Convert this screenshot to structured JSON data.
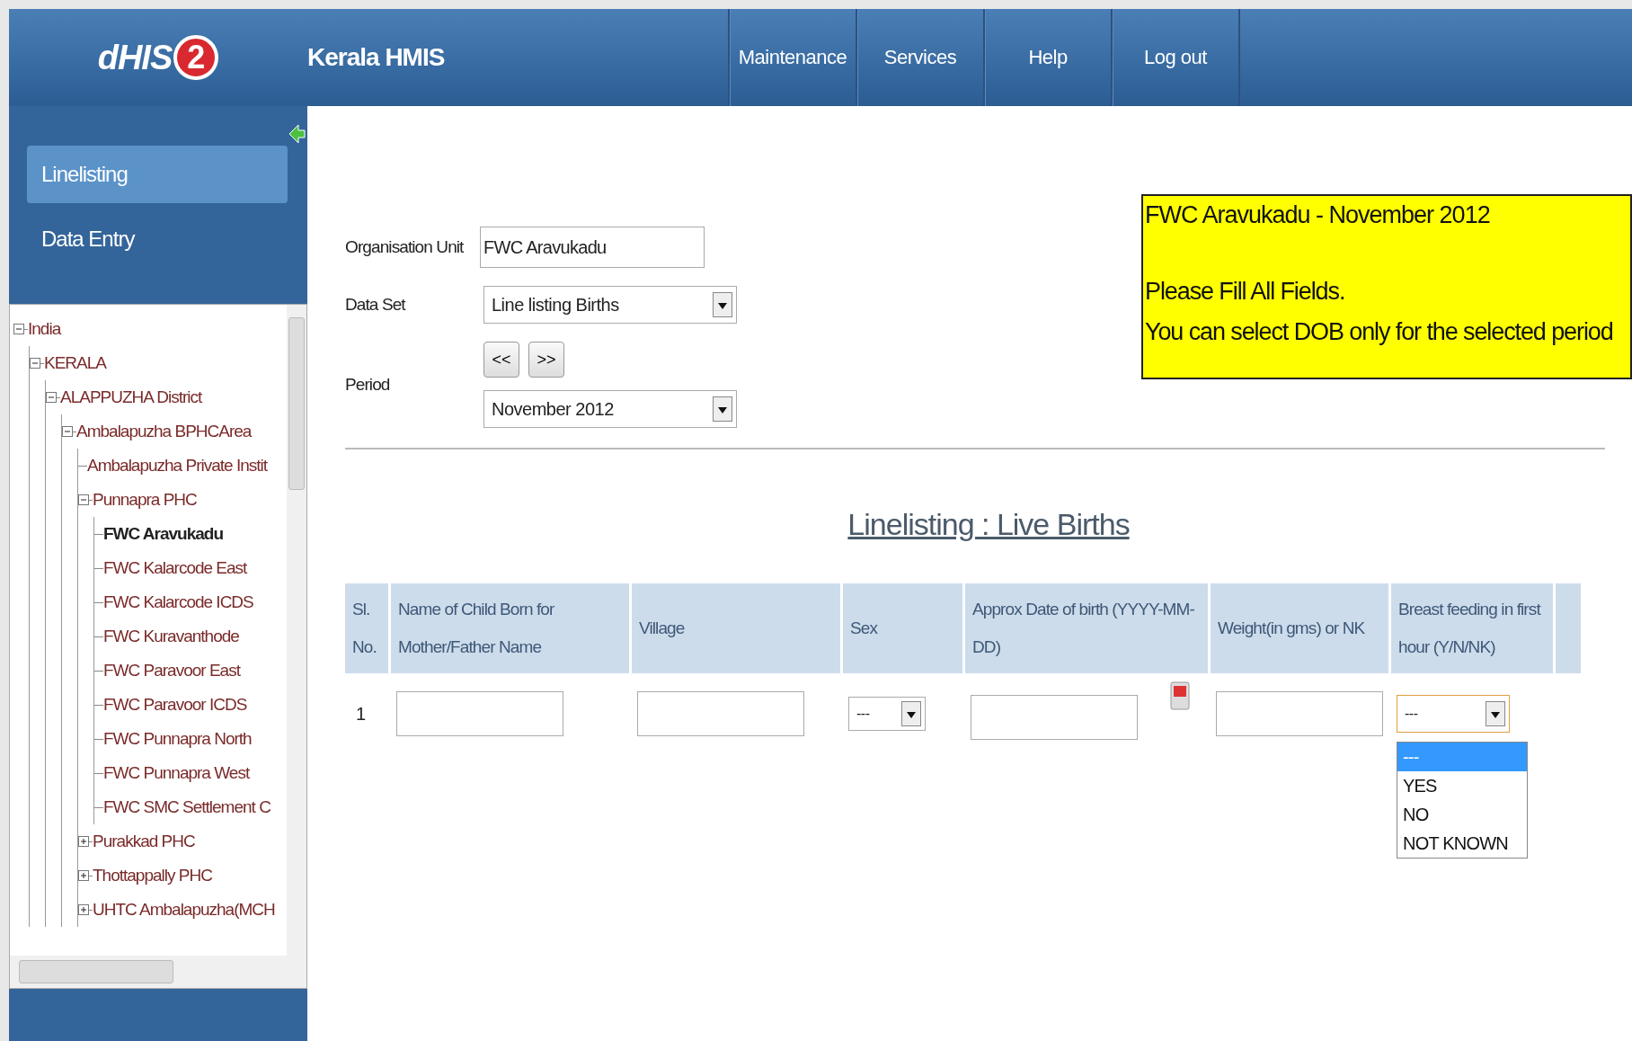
{
  "header": {
    "logo": {
      "text": "dHIS",
      "badge": "2"
    },
    "title": "Kerala HMIS",
    "menu": [
      {
        "label": "Maintenance"
      },
      {
        "label": "Services"
      },
      {
        "label": "Help"
      },
      {
        "label": "Log out"
      }
    ]
  },
  "sidebar": {
    "items": [
      {
        "label": "Linelisting",
        "selected": true
      },
      {
        "label": "Data Entry",
        "selected": false
      }
    ],
    "tree": [
      {
        "label": "India",
        "kind": "branch",
        "expanded": true,
        "selected": false,
        "children": [
          {
            "label": "KERALA",
            "kind": "branch",
            "expanded": true,
            "selected": false,
            "children": [
              {
                "label": "ALAPPUZHA District",
                "kind": "branch",
                "expanded": true,
                "selected": false,
                "children": [
                  {
                    "label": "Ambalapuzha BPHCArea",
                    "kind": "branch",
                    "expanded": true,
                    "selected": false,
                    "children": [
                      {
                        "label": "Ambalapuzha Private Instit",
                        "kind": "leaf",
                        "selected": false
                      },
                      {
                        "label": "Punnapra PHC",
                        "kind": "branch",
                        "expanded": true,
                        "selected": false,
                        "children": [
                          {
                            "label": "FWC Aravukadu",
                            "kind": "leaf",
                            "selected": true
                          },
                          {
                            "label": "FWC Kalarcode East",
                            "kind": "leaf",
                            "selected": false
                          },
                          {
                            "label": "FWC Kalarcode ICDS",
                            "kind": "leaf",
                            "selected": false
                          },
                          {
                            "label": "FWC Kuravanthode",
                            "kind": "leaf",
                            "selected": false
                          },
                          {
                            "label": "FWC Paravoor East",
                            "kind": "leaf",
                            "selected": false
                          },
                          {
                            "label": "FWC Paravoor ICDS",
                            "kind": "leaf",
                            "selected": false
                          },
                          {
                            "label": "FWC Punnapra North",
                            "kind": "leaf",
                            "selected": false
                          },
                          {
                            "label": "FWC Punnapra West",
                            "kind": "leaf",
                            "selected": false
                          },
                          {
                            "label": "FWC SMC Settlement C",
                            "kind": "leaf",
                            "selected": false
                          }
                        ]
                      },
                      {
                        "label": "Purakkad PHC",
                        "kind": "branch",
                        "expanded": false,
                        "selected": false
                      },
                      {
                        "label": "Thottappally PHC",
                        "kind": "branch",
                        "expanded": false,
                        "selected": false
                      },
                      {
                        "label": "UHTC Ambalapuzha(MCH",
                        "kind": "branch",
                        "expanded": false,
                        "selected": false
                      }
                    ]
                  }
                ]
              }
            ]
          }
        ]
      }
    ]
  },
  "form": {
    "org_unit": {
      "label": "Organisation Unit",
      "value": "FWC Aravukadu"
    },
    "data_set": {
      "label": "Data Set",
      "value": "Line listing Births"
    },
    "period": {
      "label": "Period",
      "prev": "<<",
      "next": ">>",
      "value": "November 2012"
    }
  },
  "notice": {
    "title": "FWC Aravukadu - November 2012",
    "lines": [
      "Please Fill All Fields.",
      "You can select DOB only for the selected period"
    ]
  },
  "section_title": "Linelisting : Live Births",
  "table": {
    "columns": [
      {
        "label": "Sl. No."
      },
      {
        "label": "Name of Child Born for Mother/Father Name"
      },
      {
        "label": "Village"
      },
      {
        "label": "Sex"
      },
      {
        "label": "Approx Date of birth (YYYY-MM-DD)"
      },
      {
        "label": "Weight(in gms) or NK"
      },
      {
        "label": "Breast feeding in first hour (Y/N/NK)"
      }
    ],
    "rows": [
      {
        "cells": [
          {
            "kind": "number",
            "value": "1"
          },
          {
            "kind": "text"
          },
          {
            "kind": "text"
          },
          {
            "kind": "select",
            "value": "---"
          },
          {
            "kind": "date"
          },
          {
            "kind": "text"
          },
          {
            "kind": "select",
            "value": "---",
            "open": true,
            "options": [
              {
                "label": "---",
                "selected": true
              },
              {
                "label": "YES",
                "selected": false
              },
              {
                "label": "NO",
                "selected": false
              },
              {
                "label": "NOT KNOWN",
                "selected": false
              }
            ]
          }
        ]
      }
    ]
  }
}
